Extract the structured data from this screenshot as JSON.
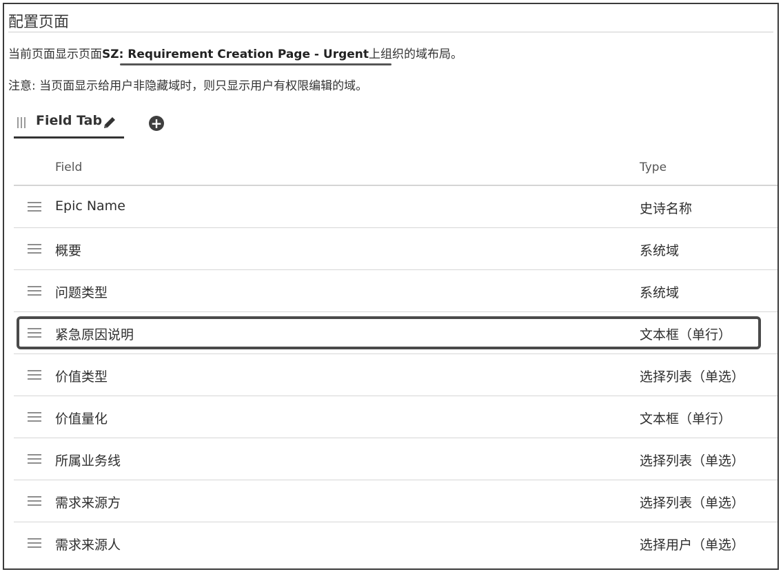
{
  "page": {
    "title": "配置页面",
    "current_prefix": "当前页面显示页面",
    "page_name": "SZ: Requirement Creation Page - Urgent",
    "current_suffix": "上组织的域布局。",
    "note": "注意: 当页面显示给用户非隐藏域时，则只显示用户有权限编辑的域。"
  },
  "tabs": [
    {
      "label": "Field Tab",
      "active": true
    }
  ],
  "icons": {
    "tab_grip": "grip-vertical-icon",
    "tab_edit": "pencil-icon",
    "add_tab": "plus-circle-icon",
    "row_drag": "drag-handle-icon"
  },
  "table": {
    "headers": {
      "field": "Field",
      "type": "Type"
    },
    "rows": [
      {
        "field": "Epic Name",
        "type": "史诗名称"
      },
      {
        "field": "概要",
        "type": "系统域"
      },
      {
        "field": "问题类型",
        "type": "系统域"
      },
      {
        "field": "紧急原因说明",
        "type": "文本框（单行）",
        "highlighted": true
      },
      {
        "field": "价值类型",
        "type": "选择列表（单选）"
      },
      {
        "field": "价值量化",
        "type": "文本框（单行）"
      },
      {
        "field": "所属业务线",
        "type": "选择列表（单选）"
      },
      {
        "field": "需求来源方",
        "type": "选择列表（单选）"
      },
      {
        "field": "需求来源人",
        "type": "选择用户（单选）"
      }
    ]
  }
}
